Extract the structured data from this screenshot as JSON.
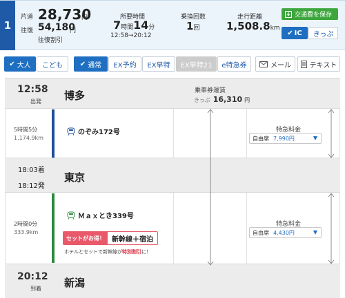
{
  "route": {
    "number": "1",
    "fare_oneway_label": "片道",
    "fare_oneway_value": "28,730",
    "fare_roundtrip_label": "往復",
    "fare_roundtrip_value": "54,180",
    "yen": "円",
    "discount_label": "往復割引",
    "duration_label": "所要時間",
    "duration_hours": "7",
    "hours_unit": "時間",
    "duration_minutes": "14",
    "minutes_unit": "分",
    "time_range": "12:58→20:12",
    "transfers_label": "乗換回数",
    "transfers_value": "1",
    "transfers_unit": "回",
    "distance_label": "走行距離",
    "distance_value": "1,508.8",
    "distance_unit": "km",
    "save_fare_label": "交通費を保存",
    "ic_label": "IC",
    "kippu_label": "きっぷ"
  },
  "toolbar": {
    "adult": "大人",
    "child": "こども",
    "normal": "通常",
    "ex_reserve": "EX予約",
    "ex_hayatoku": "EX早特",
    "ex_hayatoku21": "EX早特21",
    "e_tokkyu": "e特急券",
    "mail": "メール",
    "text": "テキスト"
  },
  "segments": {
    "s1_time": "12:58",
    "s1_type": "出発",
    "s1_name": "博多",
    "fare_header": "乗車券運賃",
    "fare_kippu": "きっぷ",
    "fare_value": "16,310",
    "fare_yen": "円",
    "leg1_duration": "5時間5分",
    "leg1_distance": "1,174.9km",
    "leg1_train": "のぞみ172号",
    "leg1_express_label": "特急料金",
    "leg1_seat": "自由席",
    "leg1_price": "7,990円",
    "s2_arr_time": "18:03着",
    "s2_dep_time": "18:12発",
    "s2_name": "東京",
    "leg2_duration": "2時間0分",
    "leg2_distance": "333.9km",
    "leg2_train": "Ｍａｘとき339号",
    "set_badge": "セットがお得！",
    "set_text": "新幹線＋宿泊",
    "set_note_a": "ホテルとセットで新幹線が",
    "set_note_b": "特別割引",
    "set_note_c": "に！",
    "leg2_express_label": "特急料金",
    "leg2_seat": "自由席",
    "leg2_price": "4,430円",
    "s3_time": "20:12",
    "s3_type": "到着",
    "s3_name": "新潟"
  }
}
